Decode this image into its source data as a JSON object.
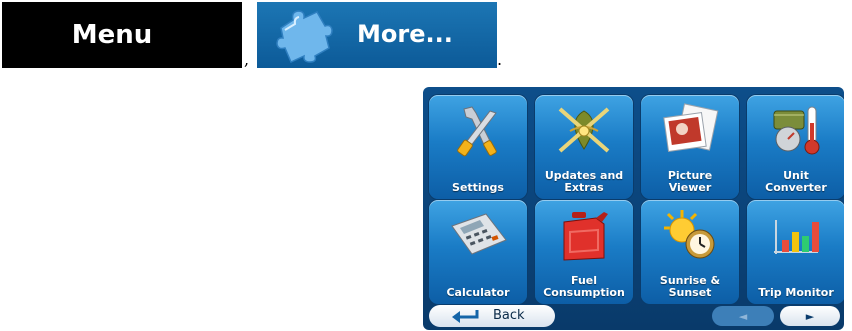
{
  "buttons": {
    "menu_label": "Menu",
    "more_label": "More...",
    "comma": ",",
    "period": "."
  },
  "tiles": [
    {
      "label": "Settings",
      "icon": "settings-icon"
    },
    {
      "label": "Updates and\nExtras",
      "icon": "updates-icon"
    },
    {
      "label": "Picture\nViewer",
      "icon": "picture-viewer-icon"
    },
    {
      "label": "Unit\nConverter",
      "icon": "unit-converter-icon"
    },
    {
      "label": "Calculator",
      "icon": "calculator-icon"
    },
    {
      "label": "Fuel\nConsumption",
      "icon": "fuel-can-icon"
    },
    {
      "label": "Sunrise &\nSunset",
      "icon": "sunrise-sunset-icon"
    },
    {
      "label": "Trip Monitor",
      "icon": "trip-monitor-icon"
    }
  ],
  "footer": {
    "back_label": "Back",
    "prev_arrow": "◄",
    "next_arrow": "►"
  },
  "colors": {
    "menu_bg": "#000000",
    "more_bg": "#1667a8",
    "tile_blue": "#1a7cc6",
    "device_bg": "#0d4e8a"
  }
}
